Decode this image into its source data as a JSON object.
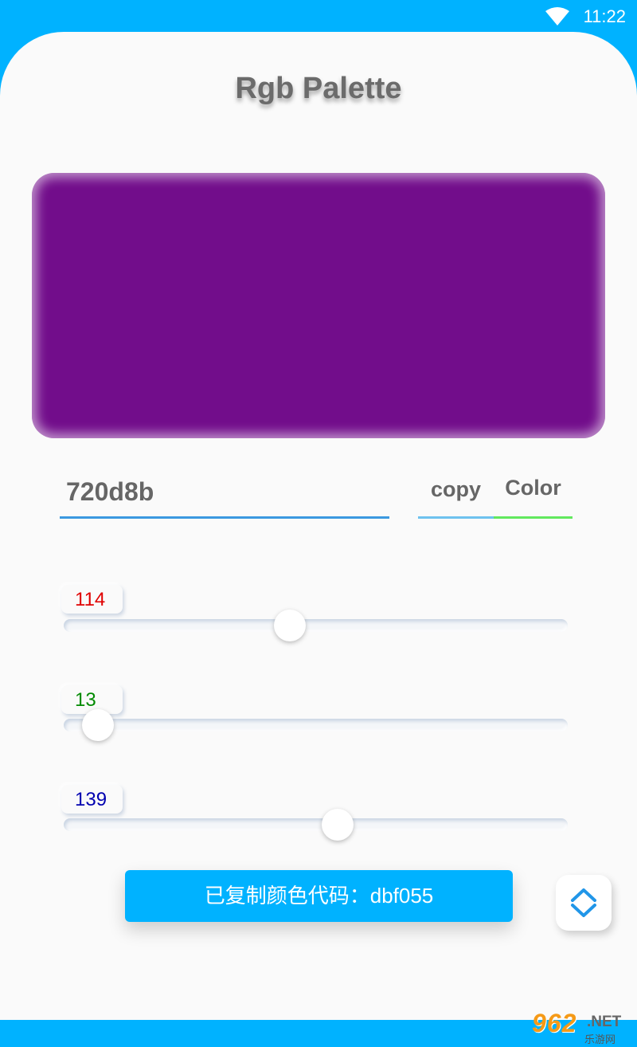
{
  "status_bar": {
    "time": "11:22",
    "wifi_icon": "wifi-icon"
  },
  "app": {
    "title": "Rgb Palette"
  },
  "preview": {
    "color": "#720d8b"
  },
  "hex_input": {
    "value": "720d8b"
  },
  "buttons": {
    "copy_label": "copy",
    "color_label": "Color"
  },
  "sliders": {
    "red": {
      "value": "114",
      "max": 255,
      "color": "#e00000"
    },
    "green": {
      "value": "13",
      "max": 255,
      "color": "#008a00"
    },
    "blue": {
      "value": "139",
      "max": 255,
      "color": "#0000b0"
    }
  },
  "toast": {
    "message": "已复制颜色代码：dbf055"
  },
  "fab": {
    "icon": "expand-collapse-icon"
  },
  "watermark": {
    "main": "962",
    "suffix": ".NET",
    "sub": "乐游网"
  }
}
